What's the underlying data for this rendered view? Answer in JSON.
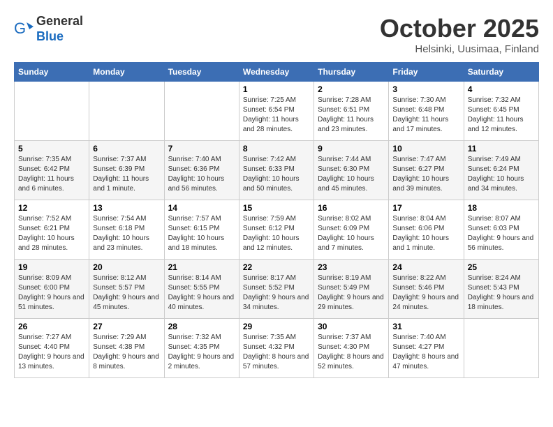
{
  "header": {
    "logo_line1": "General",
    "logo_line2": "Blue",
    "month": "October 2025",
    "location": "Helsinki, Uusimaa, Finland"
  },
  "weekdays": [
    "Sunday",
    "Monday",
    "Tuesday",
    "Wednesday",
    "Thursday",
    "Friday",
    "Saturday"
  ],
  "weeks": [
    [
      {
        "day": "",
        "text": ""
      },
      {
        "day": "",
        "text": ""
      },
      {
        "day": "",
        "text": ""
      },
      {
        "day": "1",
        "text": "Sunrise: 7:25 AM\nSunset: 6:54 PM\nDaylight: 11 hours and 28 minutes."
      },
      {
        "day": "2",
        "text": "Sunrise: 7:28 AM\nSunset: 6:51 PM\nDaylight: 11 hours and 23 minutes."
      },
      {
        "day": "3",
        "text": "Sunrise: 7:30 AM\nSunset: 6:48 PM\nDaylight: 11 hours and 17 minutes."
      },
      {
        "day": "4",
        "text": "Sunrise: 7:32 AM\nSunset: 6:45 PM\nDaylight: 11 hours and 12 minutes."
      }
    ],
    [
      {
        "day": "5",
        "text": "Sunrise: 7:35 AM\nSunset: 6:42 PM\nDaylight: 11 hours and 6 minutes."
      },
      {
        "day": "6",
        "text": "Sunrise: 7:37 AM\nSunset: 6:39 PM\nDaylight: 11 hours and 1 minute."
      },
      {
        "day": "7",
        "text": "Sunrise: 7:40 AM\nSunset: 6:36 PM\nDaylight: 10 hours and 56 minutes."
      },
      {
        "day": "8",
        "text": "Sunrise: 7:42 AM\nSunset: 6:33 PM\nDaylight: 10 hours and 50 minutes."
      },
      {
        "day": "9",
        "text": "Sunrise: 7:44 AM\nSunset: 6:30 PM\nDaylight: 10 hours and 45 minutes."
      },
      {
        "day": "10",
        "text": "Sunrise: 7:47 AM\nSunset: 6:27 PM\nDaylight: 10 hours and 39 minutes."
      },
      {
        "day": "11",
        "text": "Sunrise: 7:49 AM\nSunset: 6:24 PM\nDaylight: 10 hours and 34 minutes."
      }
    ],
    [
      {
        "day": "12",
        "text": "Sunrise: 7:52 AM\nSunset: 6:21 PM\nDaylight: 10 hours and 28 minutes."
      },
      {
        "day": "13",
        "text": "Sunrise: 7:54 AM\nSunset: 6:18 PM\nDaylight: 10 hours and 23 minutes."
      },
      {
        "day": "14",
        "text": "Sunrise: 7:57 AM\nSunset: 6:15 PM\nDaylight: 10 hours and 18 minutes."
      },
      {
        "day": "15",
        "text": "Sunrise: 7:59 AM\nSunset: 6:12 PM\nDaylight: 10 hours and 12 minutes."
      },
      {
        "day": "16",
        "text": "Sunrise: 8:02 AM\nSunset: 6:09 PM\nDaylight: 10 hours and 7 minutes."
      },
      {
        "day": "17",
        "text": "Sunrise: 8:04 AM\nSunset: 6:06 PM\nDaylight: 10 hours and 1 minute."
      },
      {
        "day": "18",
        "text": "Sunrise: 8:07 AM\nSunset: 6:03 PM\nDaylight: 9 hours and 56 minutes."
      }
    ],
    [
      {
        "day": "19",
        "text": "Sunrise: 8:09 AM\nSunset: 6:00 PM\nDaylight: 9 hours and 51 minutes."
      },
      {
        "day": "20",
        "text": "Sunrise: 8:12 AM\nSunset: 5:57 PM\nDaylight: 9 hours and 45 minutes."
      },
      {
        "day": "21",
        "text": "Sunrise: 8:14 AM\nSunset: 5:55 PM\nDaylight: 9 hours and 40 minutes."
      },
      {
        "day": "22",
        "text": "Sunrise: 8:17 AM\nSunset: 5:52 PM\nDaylight: 9 hours and 34 minutes."
      },
      {
        "day": "23",
        "text": "Sunrise: 8:19 AM\nSunset: 5:49 PM\nDaylight: 9 hours and 29 minutes."
      },
      {
        "day": "24",
        "text": "Sunrise: 8:22 AM\nSunset: 5:46 PM\nDaylight: 9 hours and 24 minutes."
      },
      {
        "day": "25",
        "text": "Sunrise: 8:24 AM\nSunset: 5:43 PM\nDaylight: 9 hours and 18 minutes."
      }
    ],
    [
      {
        "day": "26",
        "text": "Sunrise: 7:27 AM\nSunset: 4:40 PM\nDaylight: 9 hours and 13 minutes."
      },
      {
        "day": "27",
        "text": "Sunrise: 7:29 AM\nSunset: 4:38 PM\nDaylight: 9 hours and 8 minutes."
      },
      {
        "day": "28",
        "text": "Sunrise: 7:32 AM\nSunset: 4:35 PM\nDaylight: 9 hours and 2 minutes."
      },
      {
        "day": "29",
        "text": "Sunrise: 7:35 AM\nSunset: 4:32 PM\nDaylight: 8 hours and 57 minutes."
      },
      {
        "day": "30",
        "text": "Sunrise: 7:37 AM\nSunset: 4:30 PM\nDaylight: 8 hours and 52 minutes."
      },
      {
        "day": "31",
        "text": "Sunrise: 7:40 AM\nSunset: 4:27 PM\nDaylight: 8 hours and 47 minutes."
      },
      {
        "day": "",
        "text": ""
      }
    ]
  ]
}
